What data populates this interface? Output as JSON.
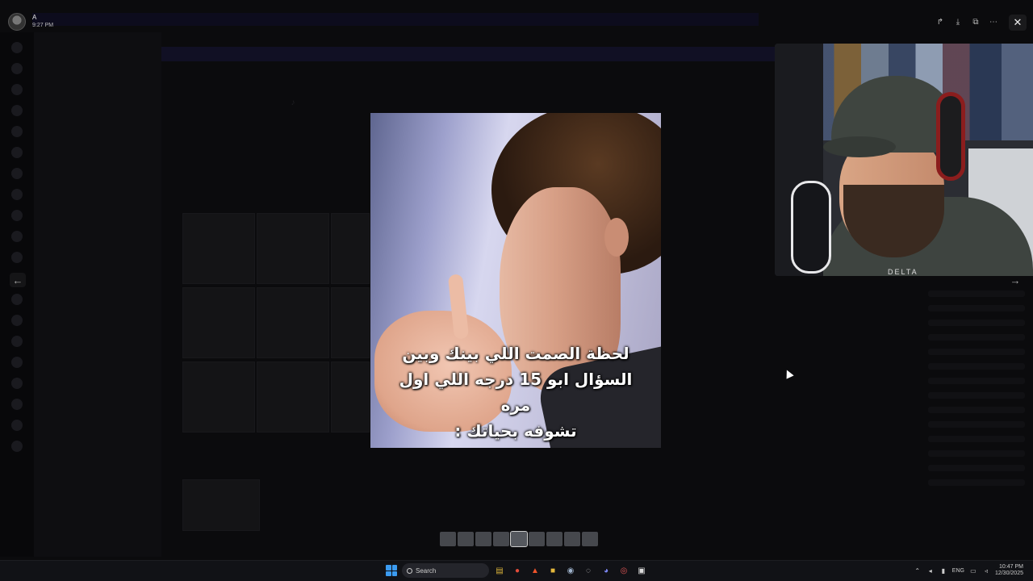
{
  "user": {
    "name": "A",
    "time": "9:27 PM"
  },
  "viewer": {
    "actions": [
      {
        "name": "forward-icon",
        "glyph": "↱"
      },
      {
        "name": "download-icon",
        "glyph": "⤓"
      },
      {
        "name": "open-external-icon",
        "glyph": "⧉"
      },
      {
        "name": "more-icon",
        "glyph": "⋯"
      }
    ],
    "close_glyph": "✕",
    "prev_glyph": "←",
    "next_glyph": "→"
  },
  "media": {
    "caption_lines": [
      "لحظة الصمت اللي بينك وبين",
      "السؤال ابو 15 درجه اللي اول مره",
      "تشوفه بحياتك :"
    ]
  },
  "webcam": {
    "shirt_text": "DELTA"
  },
  "gallery": {
    "count": 9,
    "active_index": 4
  },
  "taskbar": {
    "search_label": "Search",
    "apps": [
      {
        "name": "file-explorer-icon",
        "glyph": "▤",
        "color": "#d9b23a"
      },
      {
        "name": "chrome-icon",
        "glyph": "●",
        "color": "#e44c3a"
      },
      {
        "name": "brave-icon",
        "glyph": "▲",
        "color": "#f0542b"
      },
      {
        "name": "folder-icon",
        "glyph": "■",
        "color": "#e5b83c"
      },
      {
        "name": "steam-icon",
        "glyph": "◉",
        "color": "#9fb3cc"
      },
      {
        "name": "app-icon",
        "glyph": "◌",
        "color": "#cccccc"
      },
      {
        "name": "discord-icon",
        "glyph": "◕",
        "color": "#7b86f2"
      },
      {
        "name": "obs-icon",
        "glyph": "◎",
        "color": "#e05555"
      },
      {
        "name": "epic-games-icon",
        "glyph": "▣",
        "color": "#dddddd"
      }
    ],
    "language": "ENG",
    "clock_time": "10:47 PM",
    "clock_date": "12/30/2025"
  },
  "colors": {
    "start_blue": "#3b9bf0",
    "background": "#000000",
    "taskbar": "#111216"
  }
}
